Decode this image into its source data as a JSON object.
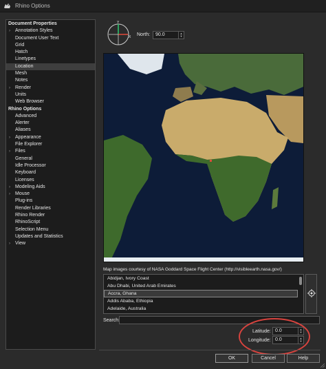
{
  "window": {
    "title": "Rhino Options"
  },
  "tree": {
    "items": [
      {
        "label": "Document Properties",
        "kind": "cat"
      },
      {
        "label": "Annotation Styles",
        "kind": "child",
        "expander": true
      },
      {
        "label": "Document User Text",
        "kind": "child"
      },
      {
        "label": "Grid",
        "kind": "child"
      },
      {
        "label": "Hatch",
        "kind": "child"
      },
      {
        "label": "Linetypes",
        "kind": "child"
      },
      {
        "label": "Location",
        "kind": "child",
        "selected": true
      },
      {
        "label": "Mesh",
        "kind": "child"
      },
      {
        "label": "Notes",
        "kind": "child"
      },
      {
        "label": "Render",
        "kind": "child",
        "expander": true
      },
      {
        "label": "Units",
        "kind": "child"
      },
      {
        "label": "Web Browser",
        "kind": "child"
      },
      {
        "label": "Rhino Options",
        "kind": "cat"
      },
      {
        "label": "Advanced",
        "kind": "child"
      },
      {
        "label": "Alerter",
        "kind": "child"
      },
      {
        "label": "Aliases",
        "kind": "child"
      },
      {
        "label": "Appearance",
        "kind": "child",
        "expander": true
      },
      {
        "label": "File Explorer",
        "kind": "child"
      },
      {
        "label": "Files",
        "kind": "child",
        "expander": true
      },
      {
        "label": "General",
        "kind": "child"
      },
      {
        "label": "Idle Processor",
        "kind": "child"
      },
      {
        "label": "Keyboard",
        "kind": "child"
      },
      {
        "label": "Licenses",
        "kind": "child"
      },
      {
        "label": "Modeling Aids",
        "kind": "child",
        "expander": true
      },
      {
        "label": "Mouse",
        "kind": "child",
        "expander": true
      },
      {
        "label": "Plug-ins",
        "kind": "child"
      },
      {
        "label": "Render Libraries",
        "kind": "child"
      },
      {
        "label": "Rhino Render",
        "kind": "child"
      },
      {
        "label": "RhinoScript",
        "kind": "child"
      },
      {
        "label": "Selection Menu",
        "kind": "child"
      },
      {
        "label": "Updates and Statistics",
        "kind": "child"
      },
      {
        "label": "View",
        "kind": "child",
        "expander": true
      }
    ]
  },
  "compass": {
    "y_label": "Y",
    "x_label": "X"
  },
  "north": {
    "label": "North:",
    "value": "90.0"
  },
  "map": {
    "credit": "Map images courtesy of NASA Goddard Space Flight Center (http://visibleearth.nasa.gov/)"
  },
  "cities": {
    "items": [
      {
        "label": "Abidjan, Ivory Coast"
      },
      {
        "label": "Abu Dhabi, United Arab Emirates"
      },
      {
        "label": "Accra, Ghana",
        "selected": true
      },
      {
        "label": "Addis Ababa, Ethiopia"
      },
      {
        "label": "Adelaide, Australia"
      }
    ]
  },
  "search": {
    "label": "Search:",
    "value": ""
  },
  "latitude": {
    "label": "Latitude:",
    "value": "0.0"
  },
  "longitude": {
    "label": "Longitude:",
    "value": "0.0"
  },
  "buttons": {
    "ok": "OK",
    "cancel": "Cancel",
    "help": "Help"
  },
  "icons": {
    "app": "rhino-icon",
    "locate": "crosshair-icon"
  },
  "colors": {
    "background": "#2b2b2b",
    "panel": "#1c1c1c",
    "annotation": "#d8433e",
    "ocean": "#0d1c38"
  }
}
